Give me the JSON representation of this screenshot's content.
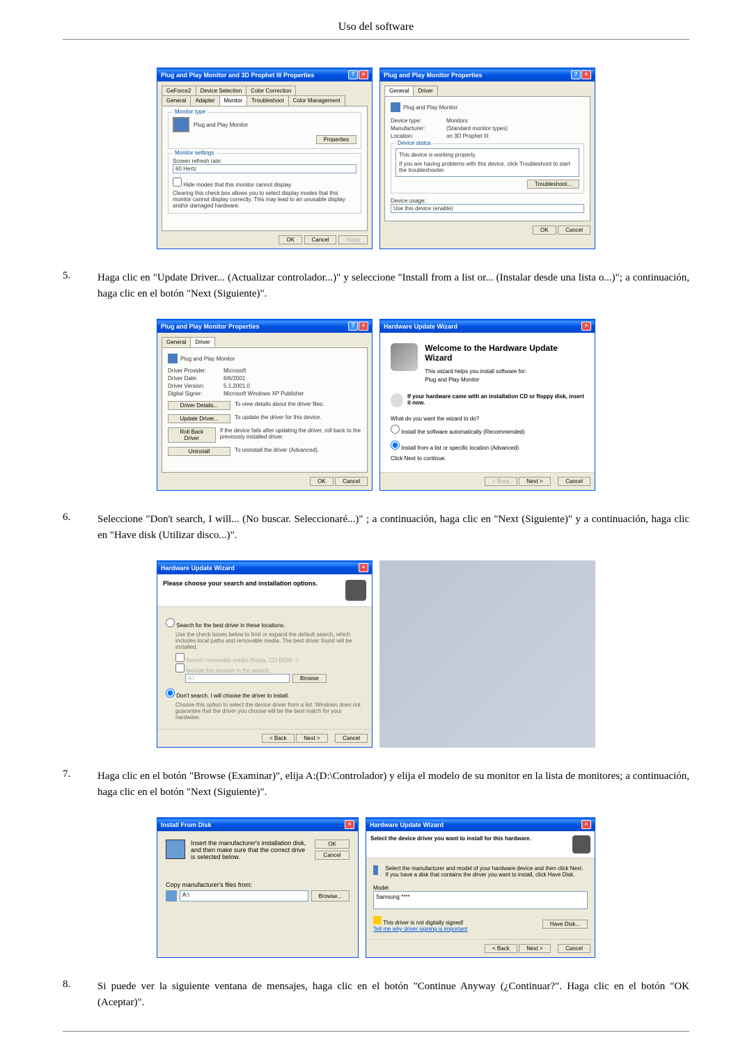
{
  "header": "Uso del software",
  "dialog1": {
    "title": "Plug and Play Monitor and 3D Prophet III Properties",
    "tabs": [
      "GeForce2",
      "Device Selection",
      "Color Correction"
    ],
    "tabs2": [
      "General",
      "Adapter",
      "Monitor",
      "Troubleshoot",
      "Color Management"
    ],
    "monitor_type_label": "Monitor type",
    "monitor_name": "Plug and Play Monitor",
    "properties_btn": "Properties",
    "settings_label": "Monitor settings",
    "refresh_label": "Screen refresh rate:",
    "refresh_value": "60 Hertz",
    "hide_modes": "Hide modes that this monitor cannot display",
    "hide_help": "Clearing this check box allows you to select display modes that this monitor cannot display correctly. This may lead to an unusable display and/or damaged hardware.",
    "ok": "OK",
    "cancel": "Cancel",
    "apply": "Apply"
  },
  "dialog2": {
    "title": "Plug and Play Monitor Properties",
    "tabs": [
      "General",
      "Driver"
    ],
    "monitor_name": "Plug and Play Monitor",
    "device_type_label": "Device type:",
    "device_type": "Monitors",
    "manufacturer_label": "Manufacturer:",
    "manufacturer": "(Standard monitor types)",
    "location_label": "Location:",
    "location": "on 3D Prophet III",
    "status_label": "Device status",
    "status_text": "This device is working properly.",
    "status_help": "If you are having problems with this device, click Troubleshoot to start the troubleshooter.",
    "troubleshoot_btn": "Troubleshoot...",
    "usage_label": "Device usage:",
    "usage_value": "Use this device (enable)",
    "ok": "OK",
    "cancel": "Cancel"
  },
  "step5": {
    "num": "5.",
    "text": "Haga clic en \"Update Driver... (Actualizar controlador...)\" y seleccione \"Install from a list or... (Instalar desde una lista o...)\"; a continuación, haga clic en el botón \"Next (Siguiente)\"."
  },
  "dialog3": {
    "title": "Plug and Play Monitor Properties",
    "tabs": [
      "General",
      "Driver"
    ],
    "monitor_name": "Plug and Play Monitor",
    "provider_label": "Driver Provider:",
    "provider": "Microsoft",
    "date_label": "Driver Date:",
    "date": "6/6/2001",
    "version_label": "Driver Version:",
    "version": "5.1.2001.0",
    "signer_label": "Digital Signer:",
    "signer": "Microsoft Windows XP Publisher",
    "details_btn": "Driver Details...",
    "details_help": "To view details about the driver files.",
    "update_btn": "Update Driver...",
    "update_help": "To update the driver for this device.",
    "rollback_btn": "Roll Back Driver",
    "rollback_help": "If the device fails after updating the driver, roll back to the previously installed driver.",
    "uninstall_btn": "Uninstall",
    "uninstall_help": "To uninstall the driver (Advanced).",
    "ok": "OK",
    "cancel": "Cancel"
  },
  "dialog4": {
    "title": "Hardware Update Wizard",
    "welcome": "Welcome to the Hardware Update Wizard",
    "helps": "This wizard helps you install software for:",
    "device": "Plug and Play Monitor",
    "cd_hint": "If your hardware came with an installation CD or floppy disk, insert it now.",
    "question": "What do you want the wizard to do?",
    "opt1": "Install the software automatically (Recommended)",
    "opt2": "Install from a list or specific location (Advanced)",
    "continue": "Click Next to continue.",
    "back": "< Back",
    "next": "Next >",
    "cancel": "Cancel"
  },
  "step6": {
    "num": "6.",
    "text": "Seleccione \"Don't search, I will... (No buscar. Seleccionaré...)\" ; a continuación, haga clic en \"Next (Siguiente)\" y a continuación, haga clic en \"Have disk (Utilizar disco...)\"."
  },
  "dialog5": {
    "title": "Hardware Update Wizard",
    "heading": "Please choose your search and installation options.",
    "opt1": "Search for the best driver in these locations.",
    "opt1_help": "Use the check boxes below to limit or expand the default search, which includes local paths and removable media. The best driver found will be installed.",
    "check1": "Search removable media (floppy, CD-ROM...)",
    "check2": "Include this location in the search:",
    "path": "A:\\",
    "browse_btn": "Browse",
    "opt2": "Don't search. I will choose the driver to install.",
    "opt2_help": "Choose this option to select the device driver from a list. Windows does not guarantee that the driver you choose will be the best match for your hardware.",
    "back": "< Back",
    "next": "Next >",
    "cancel": "Cancel"
  },
  "step7": {
    "num": "7.",
    "text": "Haga clic en el botón \"Browse (Examinar)\", elija A:(D:\\Controlador) y elija el modelo de su monitor en la lista de monitores; a continuación, haga clic en el botón \"Next (Siguiente)\"."
  },
  "dialog7": {
    "title": "Install From Disk",
    "text": "Insert the manufacturer's installation disk, and then make sure that the correct drive is selected below.",
    "ok": "OK",
    "cancel": "Cancel",
    "copy_label": "Copy manufacturer's files from:",
    "path_value": "A:\\",
    "browse": "Browse..."
  },
  "dialog8": {
    "title": "Hardware Update Wizard",
    "heading": "Select the device driver you want to install for this hardware.",
    "help": "Select the manufacturer and model of your hardware device and then click Next. If you have a disk that contains the driver you want to install, click Have Disk.",
    "model_label": "Model",
    "model_item": "Samsung ****",
    "signed": "This driver is not digitally signed!",
    "tell_me": "Tell me why driver signing is important",
    "have_disk": "Have Disk...",
    "back": "< Back",
    "next": "Next >",
    "cancel": "Cancel"
  },
  "step8": {
    "num": "8.",
    "text": "Si puede ver la siguiente ventana de mensajes, haga clic en el botón \"Continue Anyway (¿Continuar?\". Haga clic en el botón \"OK (Aceptar)\"."
  }
}
